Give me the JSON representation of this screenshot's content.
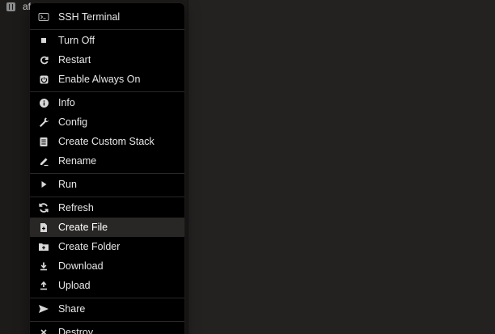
{
  "tree": {
    "item_label": "af"
  },
  "menu": {
    "items": [
      {
        "label": "SSH Terminal",
        "icon": "terminal-icon"
      },
      {
        "label": "Turn Off",
        "icon": "stop-icon"
      },
      {
        "label": "Restart",
        "icon": "restart-icon"
      },
      {
        "label": "Enable Always On",
        "icon": "power-icon"
      },
      {
        "label": "Info",
        "icon": "info-icon"
      },
      {
        "label": "Config",
        "icon": "wrench-icon"
      },
      {
        "label": "Create Custom Stack",
        "icon": "stack-icon"
      },
      {
        "label": "Rename",
        "icon": "pencil-icon"
      },
      {
        "label": "Run",
        "icon": "play-icon"
      },
      {
        "label": "Refresh",
        "icon": "refresh-icon"
      },
      {
        "label": "Create File",
        "icon": "new-file-icon",
        "active": true
      },
      {
        "label": "Create Folder",
        "icon": "new-folder-icon"
      },
      {
        "label": "Download",
        "icon": "download-icon"
      },
      {
        "label": "Upload",
        "icon": "upload-icon"
      },
      {
        "label": "Share",
        "icon": "share-icon"
      },
      {
        "label": "Destroy",
        "icon": "close-icon"
      }
    ]
  },
  "colors": {
    "background": "#242221",
    "panel": "#1d1b1a",
    "menu": "#000000",
    "active_item": "#292725",
    "text": "#e7e7e7"
  }
}
